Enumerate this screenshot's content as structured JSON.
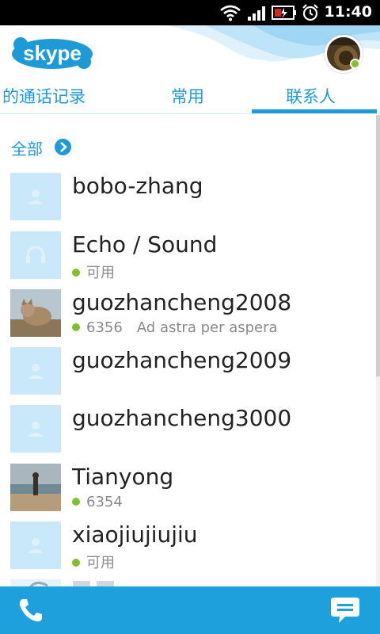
{
  "status_bar": {
    "time": "11:40",
    "icons": [
      "wifi-icon",
      "signal-icon",
      "battery-icon",
      "alarm-icon"
    ]
  },
  "header": {
    "logo": "skype",
    "presence": "online"
  },
  "tabs": [
    {
      "label": "的通话记录",
      "active": false
    },
    {
      "label": "常用",
      "active": false
    },
    {
      "label": "联系人",
      "active": true
    }
  ],
  "filter": {
    "label": "全部"
  },
  "contacts": [
    {
      "name": "bobo-zhang",
      "status": "",
      "mood": "",
      "avatar": "default"
    },
    {
      "name": "Echo / Sound",
      "status": "可用",
      "mood": "",
      "avatar": "headset"
    },
    {
      "name": "guozhancheng2008",
      "status": "6356",
      "mood": "Ad astra per aspera",
      "avatar": "cat-photo"
    },
    {
      "name": "guozhancheng2009",
      "status": "",
      "mood": "",
      "avatar": "default"
    },
    {
      "name": "guozhancheng3000",
      "status": "",
      "mood": "",
      "avatar": "default"
    },
    {
      "name": "Tianyong",
      "status": "6354",
      "mood": "",
      "avatar": "beach-photo"
    },
    {
      "name": "xiaojiujiujiu",
      "status": "可用",
      "mood": "",
      "avatar": "default"
    }
  ],
  "colors": {
    "accent": "#1e9ad6",
    "bottom_bar": "#1ea0dc",
    "online": "#7ec02d",
    "avatar_placeholder": "#c9e8f9"
  },
  "bottom_bar": {
    "left_icon": "phone-icon",
    "right_icon": "chat-icon"
  }
}
